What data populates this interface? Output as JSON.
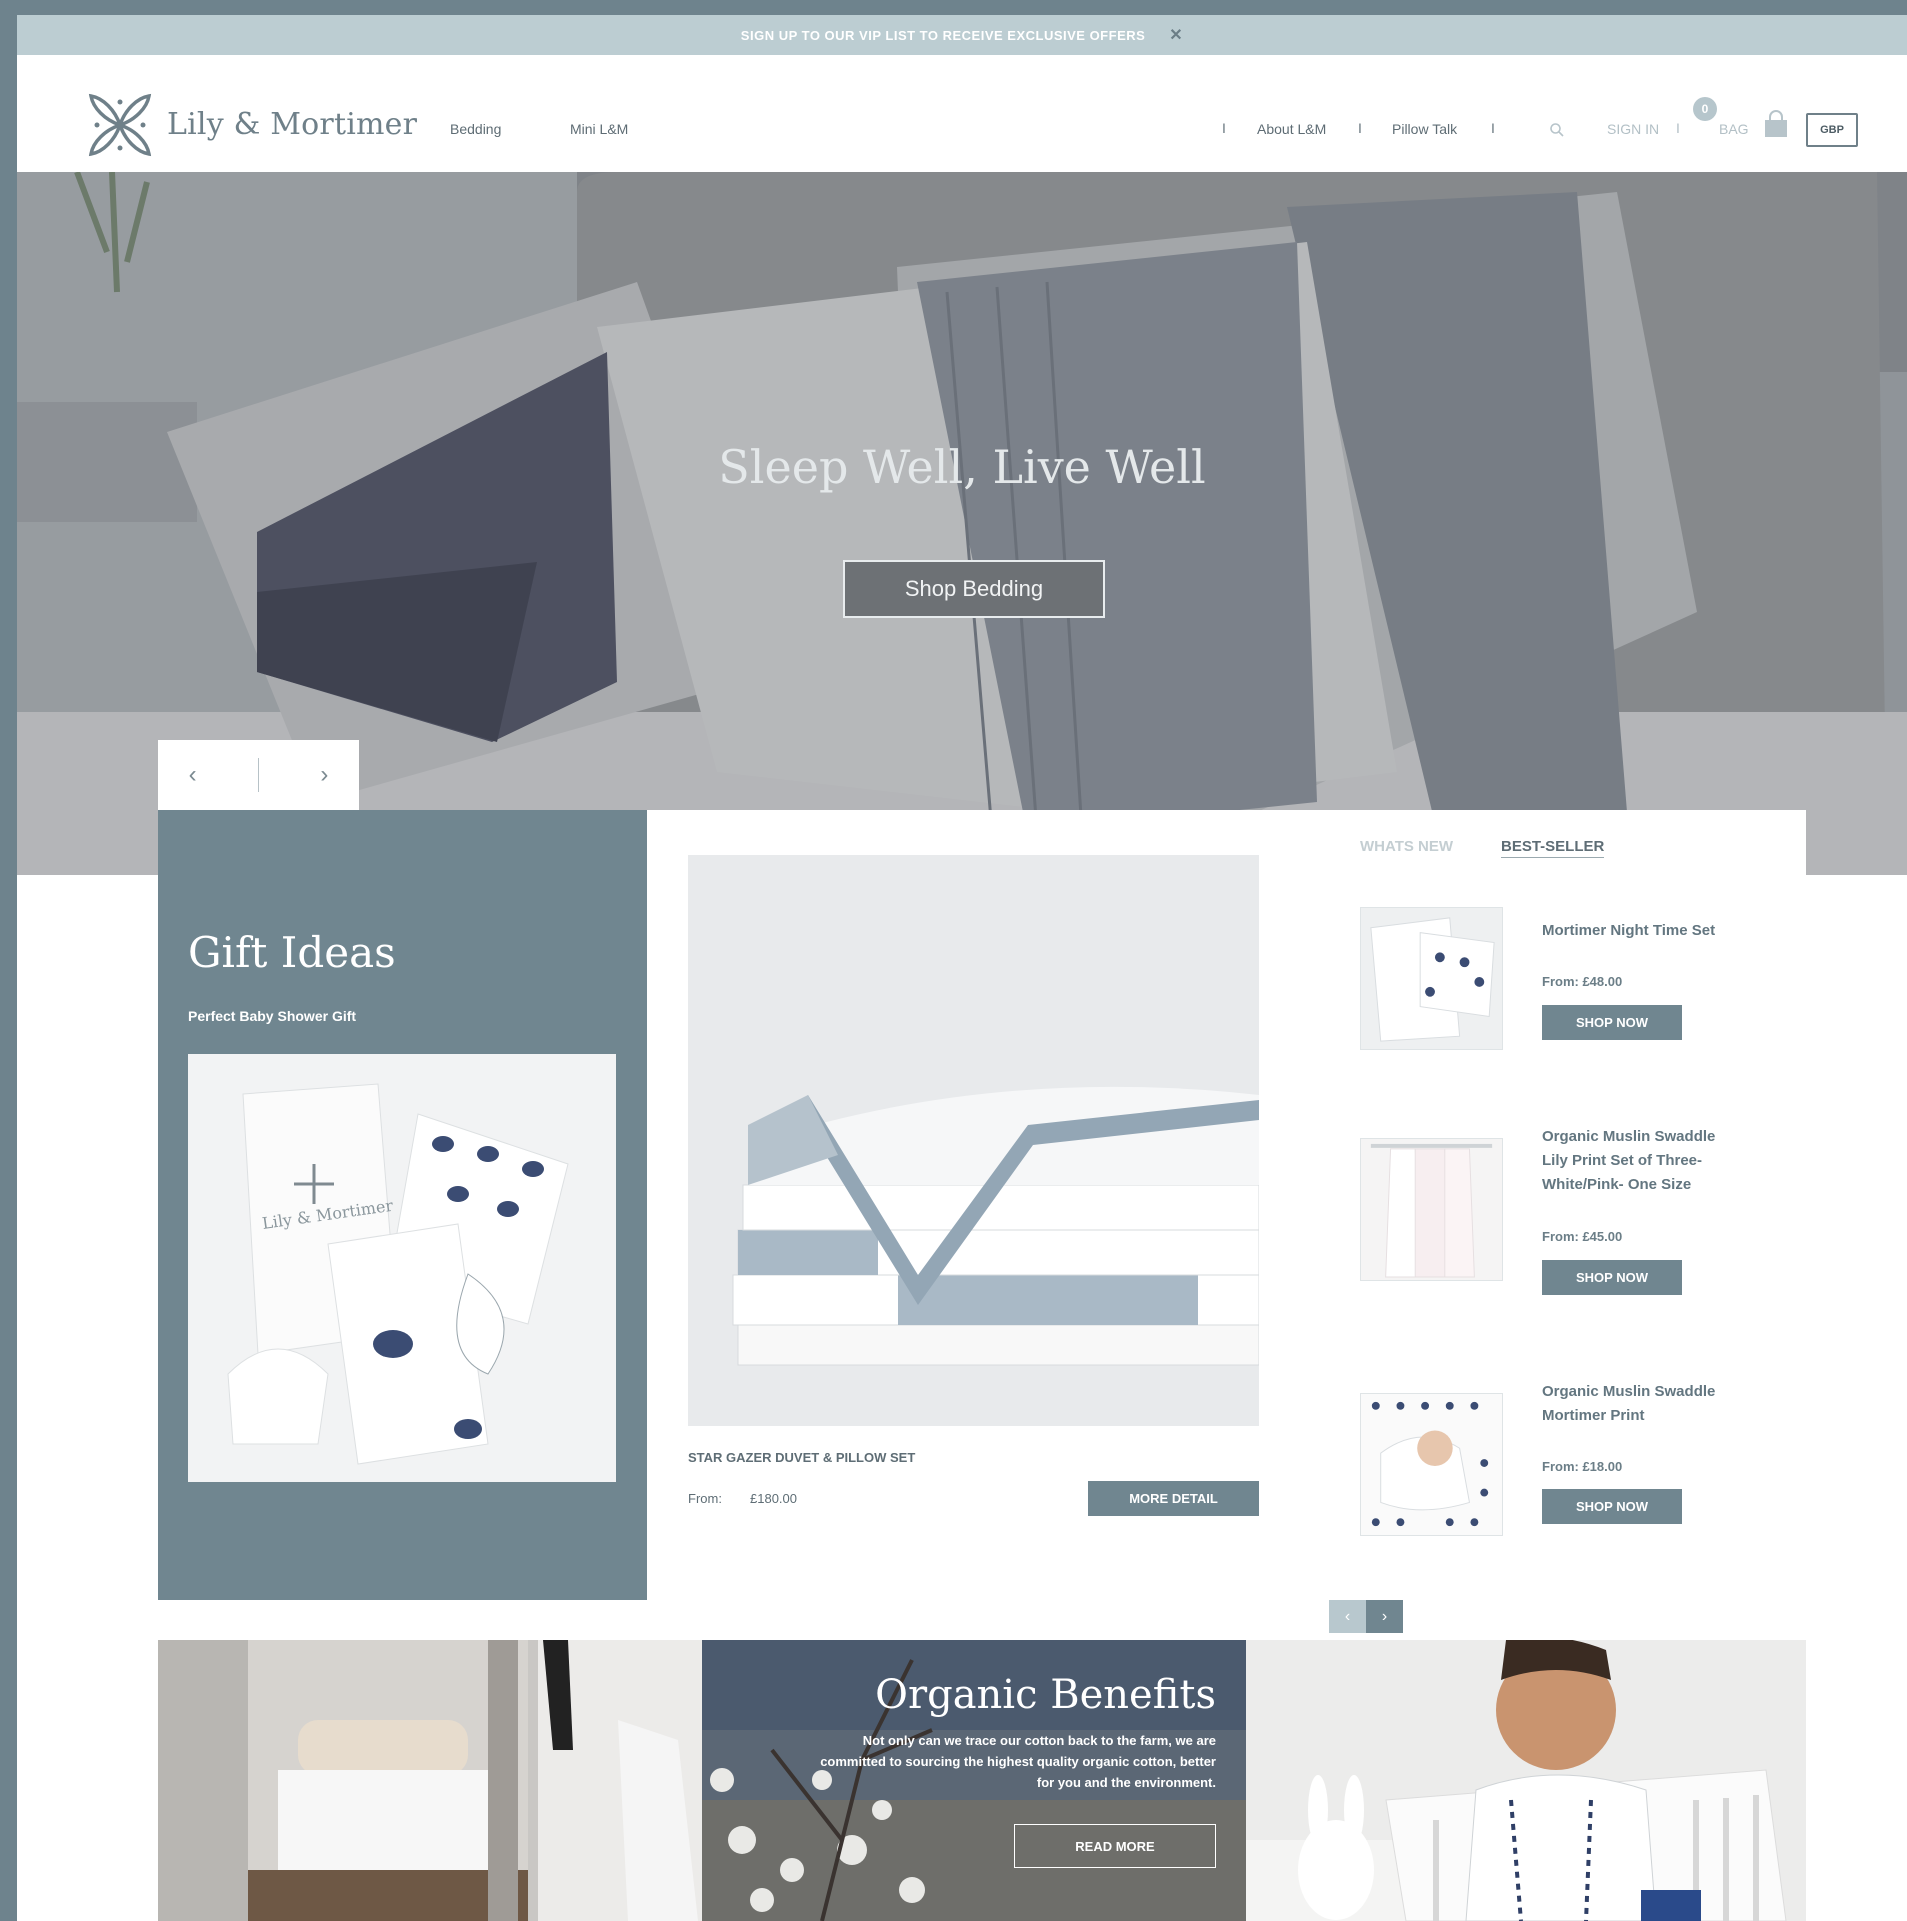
{
  "promo": {
    "text": "SIGN UP TO OUR VIP LIST TO RECEIVE EXCLUSIVE OFFERS",
    "close": "✕"
  },
  "header": {
    "brand": "Lily & Mortimer",
    "nav_left": [
      "Bedding",
      "Mini L&M"
    ],
    "nav_right": [
      "About L&M",
      "Pillow Talk"
    ],
    "separator": "I",
    "sign_in": "SIGN IN",
    "bag_label": "BAG",
    "bag_count": "0",
    "currency": "GBP",
    "icons": [
      "search-icon",
      "bag-icon"
    ]
  },
  "hero": {
    "title": "Sleep Well, Live Well",
    "button": "Shop Bedding",
    "prev": "‹",
    "next": "›"
  },
  "gift": {
    "title": "Gift Ideas",
    "subtitle": "Perfect Baby Shower Gift"
  },
  "featured": {
    "name": "STAR GAZER DUVET & PILLOW SET",
    "from_label": "From:",
    "price": "£180.00",
    "button": "MORE DETAIL"
  },
  "tabs": {
    "whats_new": "WHATS NEW",
    "best_seller": "BEST-SELLER"
  },
  "bestsellers": [
    {
      "name": "Mortimer Night Time Set",
      "price": "From: £48.00",
      "button": "SHOP NOW"
    },
    {
      "name": "Organic Muslin Swaddle Lily Print Set of Three-White/Pink- One Size",
      "price": "From: £45.00",
      "button": "SHOP NOW"
    },
    {
      "name": "Organic Muslin Swaddle Mortimer Print",
      "price": "From: £18.00",
      "button": "SHOP NOW"
    }
  ],
  "pager": {
    "prev": "‹",
    "next": "›"
  },
  "organic": {
    "title": "Organic Benefits",
    "body": "Not only can we trace our cotton back to the farm, we are committed to sourcing the highest quality organic cotton, better for you and the environment.",
    "button": "READ MORE"
  },
  "colors": {
    "brand_slate": "#708690",
    "promo_bar": "#bccdd2",
    "frame": "#6e838d"
  }
}
